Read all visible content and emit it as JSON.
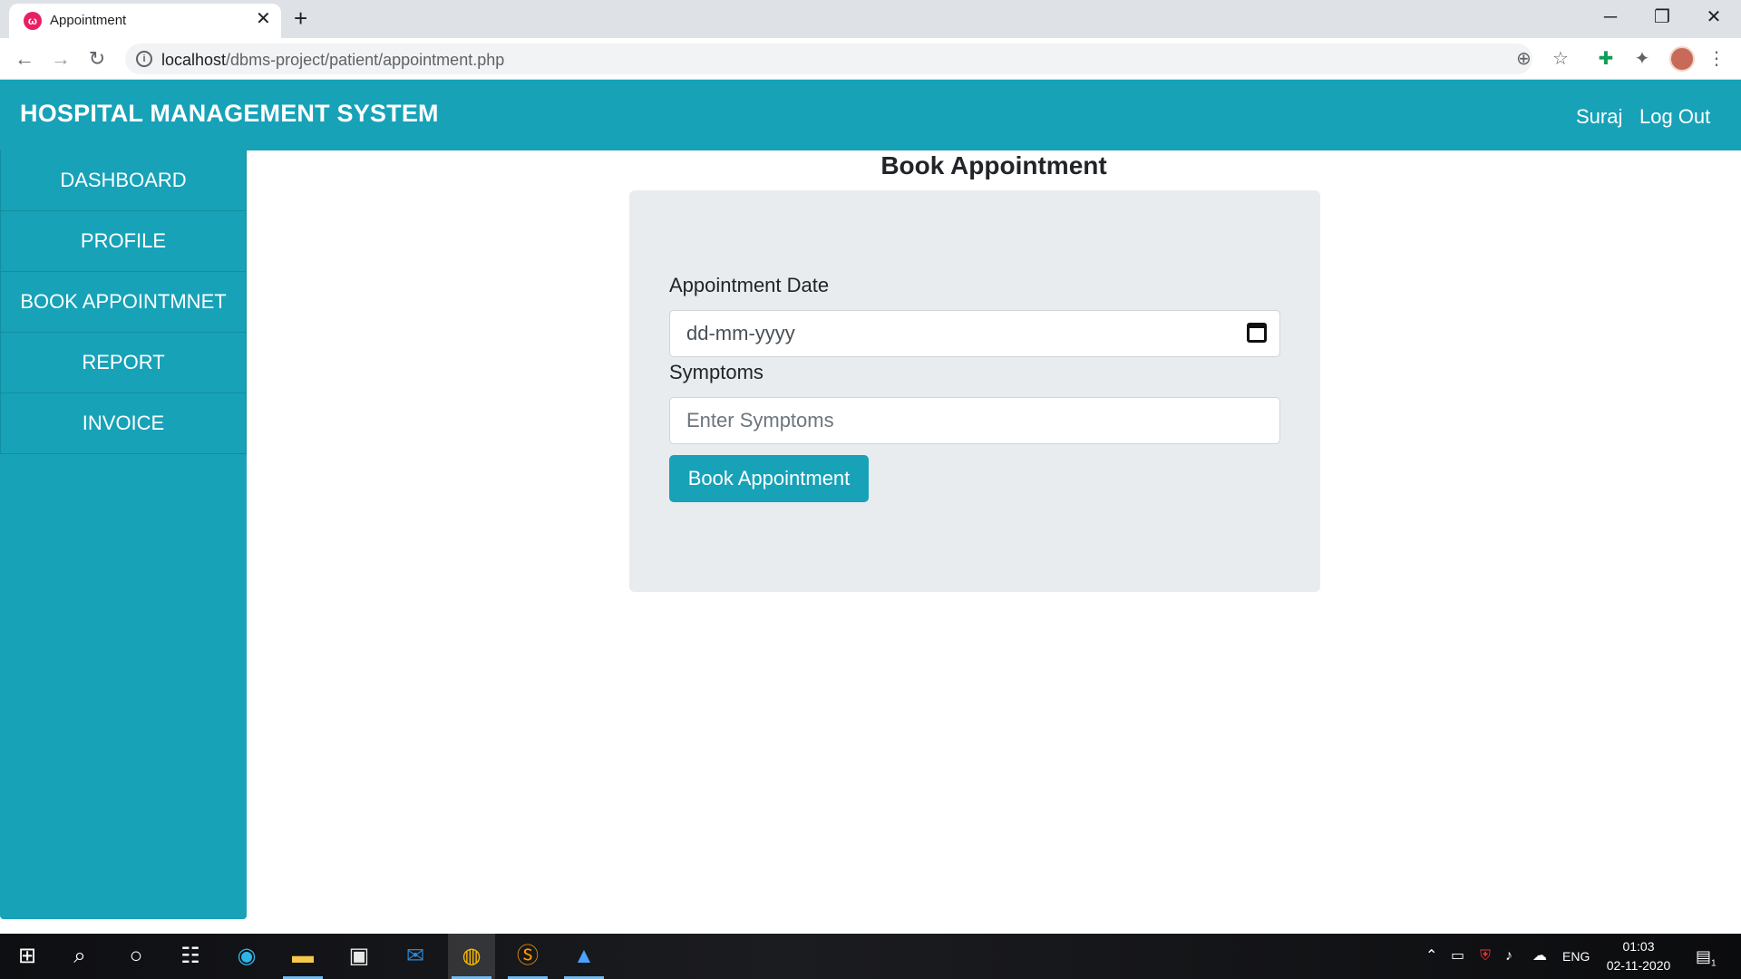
{
  "browser": {
    "tab_title": "Appointment",
    "tab_favicon": "ω",
    "url_host": "localhost",
    "url_path": "/dbms-project/patient/appointment.php"
  },
  "header": {
    "brand": "HOSPITAL MANAGEMENT SYSTEM",
    "user": "Suraj",
    "logout": "Log Out"
  },
  "sidebar": {
    "items": [
      {
        "label": "DASHBOARD"
      },
      {
        "label": "PROFILE"
      },
      {
        "label": "BOOK APPOINTMNET"
      },
      {
        "label": "REPORT"
      },
      {
        "label": "INVOICE"
      }
    ]
  },
  "main": {
    "title": "Book Appointment",
    "form": {
      "date_label": "Appointment Date",
      "date_placeholder": "dd-mm-yyyy",
      "symptoms_label": "Symptoms",
      "symptoms_placeholder": "Enter Symptoms",
      "submit_label": "Book Appointment"
    }
  },
  "taskbar": {
    "language": "ENG",
    "time": "01:03",
    "date": "02-11-2020",
    "notification_count": "1"
  },
  "colors": {
    "accent": "#17a2b8",
    "card_bg": "#e9ecef",
    "browser_tabstrip": "#dee1e6"
  }
}
